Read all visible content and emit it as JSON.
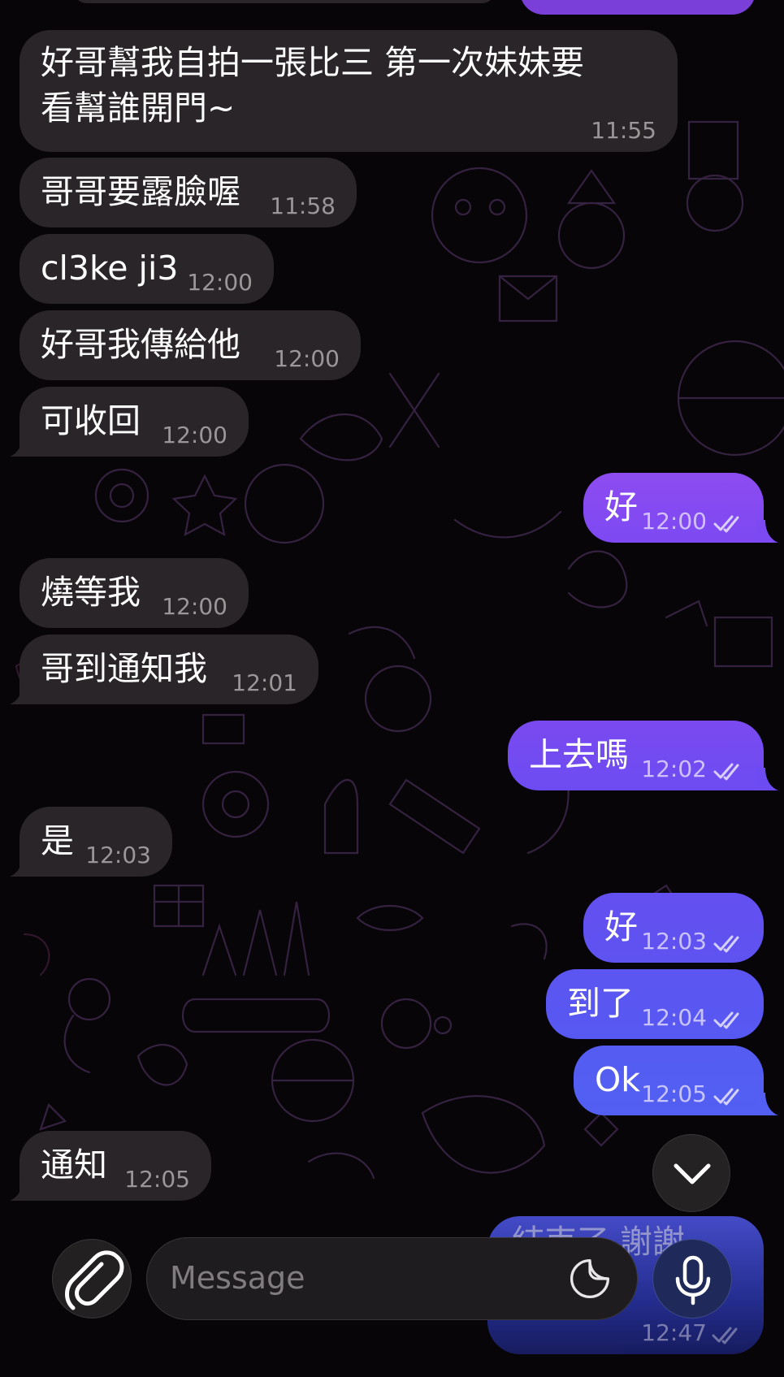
{
  "messages": [
    {
      "dir": "in",
      "text_line1": "好哥幫我自拍一張比三 第一次妹妹要",
      "text_line2": "看幫誰開門~",
      "time": "11:55"
    },
    {
      "dir": "in",
      "text": "哥哥要露臉喔",
      "time": "11:58"
    },
    {
      "dir": "in",
      "text": "cl3ke ji3",
      "time": "12:00"
    },
    {
      "dir": "in",
      "text": "好哥我傳給他",
      "time": "12:00"
    },
    {
      "dir": "in",
      "text": "可收回",
      "time": "12:00"
    },
    {
      "dir": "out",
      "text": "好",
      "time": "12:00"
    },
    {
      "dir": "in",
      "text": "燒等我",
      "time": "12:00"
    },
    {
      "dir": "in",
      "text": "哥到通知我",
      "time": "12:01"
    },
    {
      "dir": "out",
      "text": "上去嗎",
      "time": "12:02"
    },
    {
      "dir": "in",
      "text": "是",
      "time": "12:03"
    },
    {
      "dir": "out",
      "text": "好",
      "time": "12:03"
    },
    {
      "dir": "out",
      "text": "到了",
      "time": "12:04"
    },
    {
      "dir": "out",
      "text": "Ok",
      "time": "12:05"
    },
    {
      "dir": "in",
      "text": "通知",
      "time": "12:05"
    },
    {
      "dir": "out",
      "text": "結束了 謝謝",
      "time": "12:47"
    }
  ],
  "composer": {
    "placeholder": "Message",
    "attach_icon": "paperclip-icon",
    "sticker_icon": "sticker-icon",
    "mic_icon": "microphone-icon"
  },
  "scroll_down_icon": "chevron-down-icon",
  "colors": {
    "incoming_bubble": "#2a2528",
    "outgoing_top": "#8a4ff0",
    "outgoing_bottom": "#4f63f0",
    "background": "#070508"
  }
}
